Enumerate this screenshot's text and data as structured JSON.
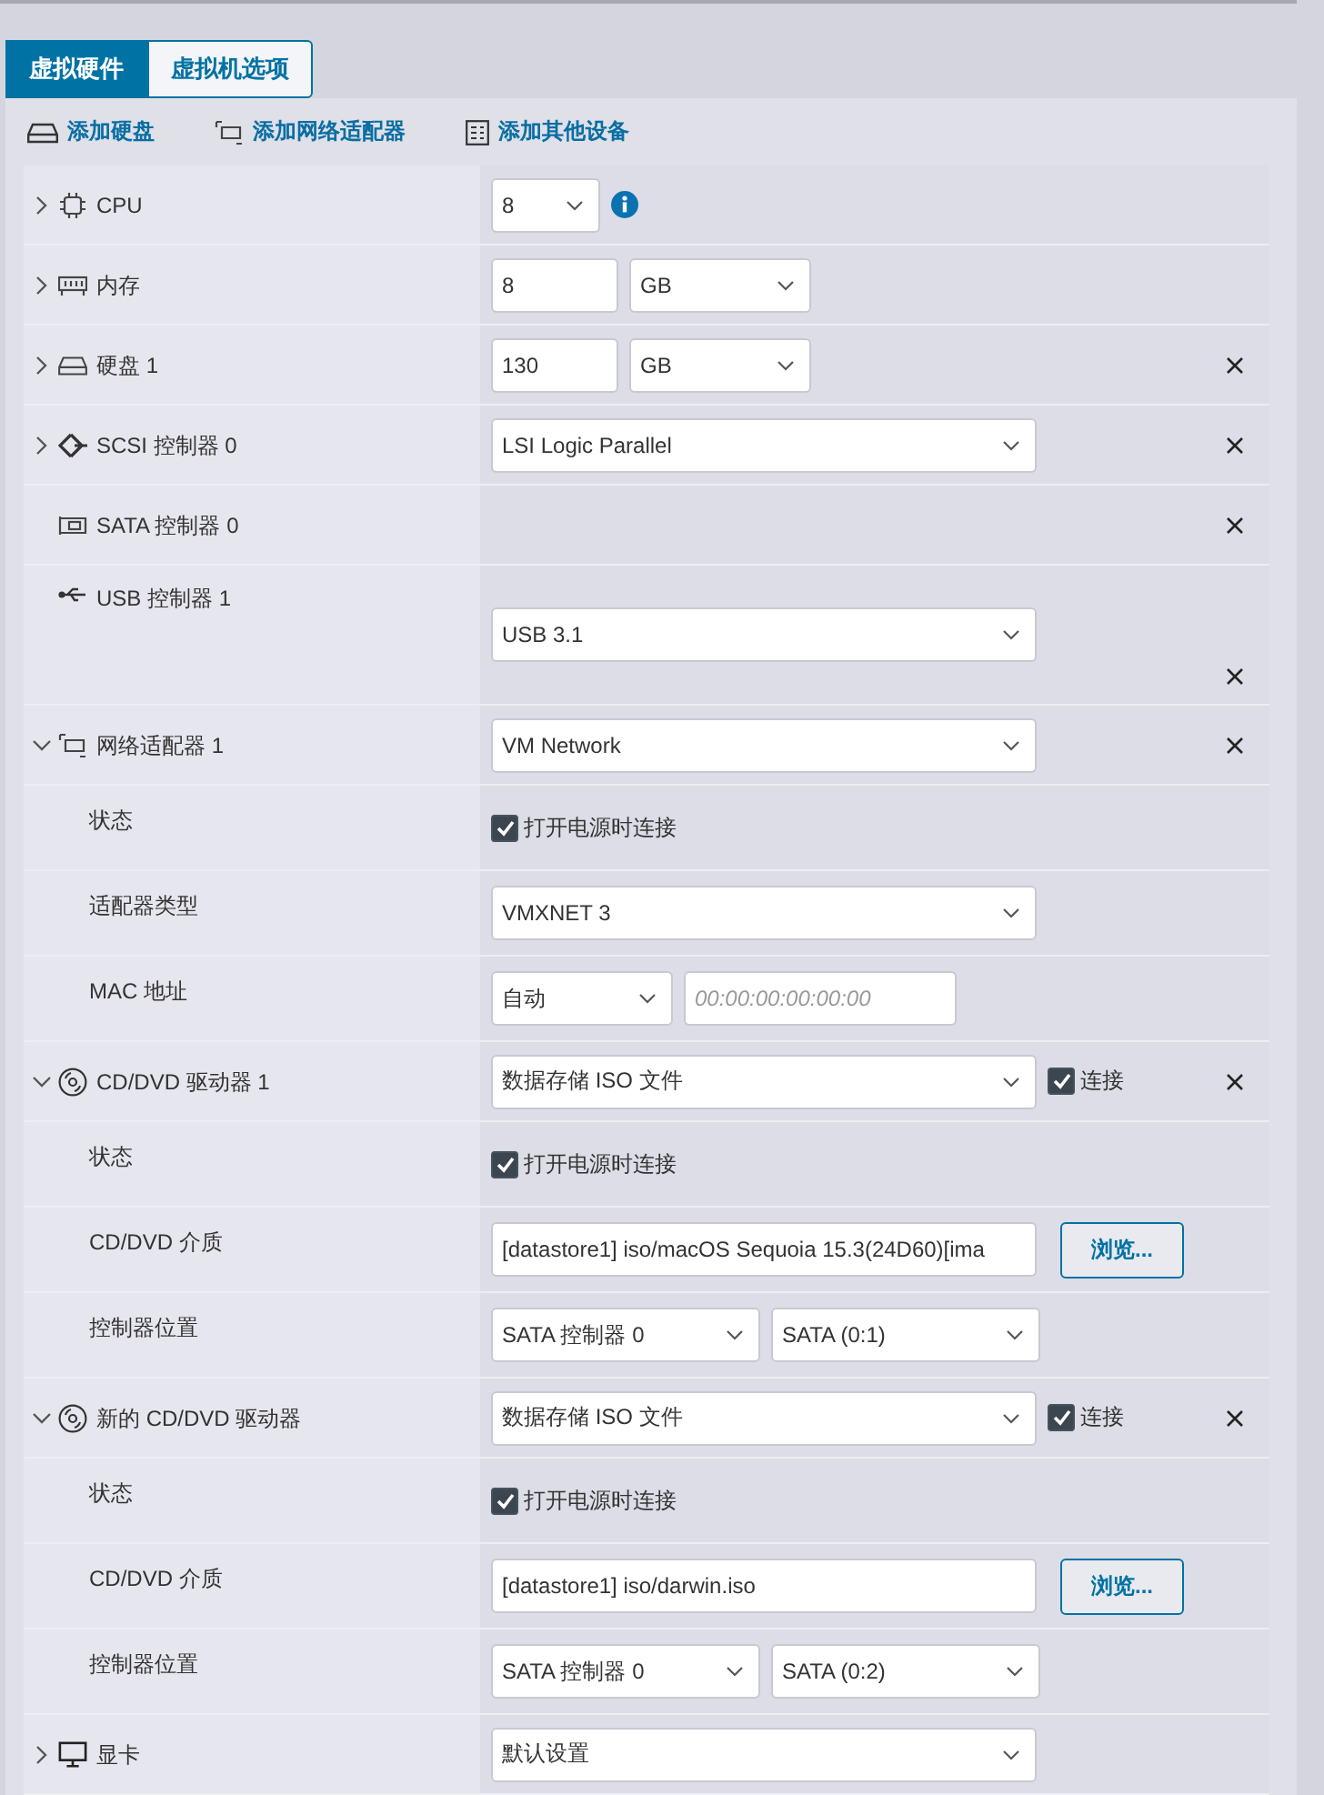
{
  "tabs": [
    {
      "label": "虚拟硬件",
      "selected": true
    },
    {
      "label": "虚拟机选项",
      "selected": false
    }
  ],
  "toolbar": [
    {
      "label": "添加硬盘"
    },
    {
      "label": "添加网络适配器"
    },
    {
      "label": "添加其他设备"
    }
  ],
  "rows": [
    {
      "kind": "cpu",
      "label": "CPU",
      "expanded": false,
      "removable": false,
      "controls": [
        {
          "kind": "picker",
          "value": "8"
        },
        {
          "kind": "info"
        }
      ]
    },
    {
      "kind": "memory",
      "label": "内存",
      "expanded": false,
      "removable": false,
      "controls": [
        {
          "kind": "number",
          "value": "8"
        },
        {
          "kind": "unit",
          "value": "GB"
        }
      ]
    },
    {
      "kind": "disk",
      "label": "硬盘 1",
      "expanded": false,
      "removable": true,
      "controls": [
        {
          "kind": "number",
          "value": "130"
        },
        {
          "kind": "unit",
          "value": "GB"
        }
      ]
    },
    {
      "kind": "scsi",
      "label": "SCSI 控制器 0",
      "expanded": false,
      "removable": true,
      "controls": [
        {
          "kind": "list",
          "value": "LSI Logic Parallel"
        }
      ]
    },
    {
      "kind": "sata",
      "label": "SATA 控制器 0",
      "removable": true,
      "controls": []
    },
    {
      "kind": "usb",
      "label": "USB 控制器 1",
      "removable": true,
      "controls": [
        {
          "kind": "list",
          "value": "USB 3.1"
        }
      ]
    },
    {
      "kind": "network",
      "label": "网络适配器 1",
      "expanded": true,
      "removable": true,
      "controls": [
        {
          "kind": "list",
          "value": "VM Network"
        }
      ],
      "children": [
        {
          "label": "状态",
          "controls": [
            {
              "kind": "checkbox",
              "label": "打开电源时连接",
              "checked": true
            }
          ]
        },
        {
          "label": "适配器类型",
          "controls": [
            {
              "kind": "list",
              "value": "VMXNET 3"
            }
          ]
        },
        {
          "label": "MAC 地址",
          "controls": [
            {
              "kind": "unit",
              "value": "自动"
            },
            {
              "kind": "address",
              "placeholder": "00:00:00:00:00:00"
            }
          ]
        }
      ]
    },
    {
      "kind": "cdrom",
      "label": "CD/DVD 驱动器 1",
      "expanded": true,
      "removable": true,
      "controls": [
        {
          "kind": "list",
          "value": "数据存储 ISO 文件"
        },
        {
          "kind": "checkbox",
          "label": "连接",
          "checked": true
        }
      ],
      "children": [
        {
          "label": "状态",
          "controls": [
            {
              "kind": "checkbox",
              "label": "打开电源时连接",
              "checked": true
            }
          ]
        },
        {
          "label": "CD/DVD 介质",
          "controls": [
            {
              "kind": "path",
              "value": "[datastore1] iso/macOS Sequoia 15.3(24D60)[ima"
            },
            {
              "kind": "button",
              "label": "浏览..."
            }
          ]
        },
        {
          "label": "控制器位置",
          "controls": [
            {
              "kind": "pair",
              "value": "SATA 控制器 0"
            },
            {
              "kind": "pair",
              "value": "SATA (0:1)"
            }
          ]
        }
      ]
    },
    {
      "kind": "cdrom",
      "label": "新的 CD/DVD 驱动器",
      "expanded": true,
      "removable": true,
      "controls": [
        {
          "kind": "list",
          "value": "数据存储 ISO 文件"
        },
        {
          "kind": "checkbox",
          "label": "连接",
          "checked": true
        }
      ],
      "children": [
        {
          "label": "状态",
          "controls": [
            {
              "kind": "checkbox",
              "label": "打开电源时连接",
              "checked": true
            }
          ]
        },
        {
          "label": "CD/DVD 介质",
          "controls": [
            {
              "kind": "path",
              "value": "[datastore1] iso/darwin.iso"
            },
            {
              "kind": "button",
              "label": "浏览..."
            }
          ]
        },
        {
          "label": "控制器位置",
          "controls": [
            {
              "kind": "pair",
              "value": "SATA 控制器 0"
            },
            {
              "kind": "pair",
              "value": "SATA (0:2)"
            }
          ]
        }
      ]
    },
    {
      "kind": "display",
      "label": "显卡",
      "expanded": false,
      "removable": false,
      "controls": [
        {
          "kind": "list",
          "value": "默认设置"
        }
      ]
    }
  ]
}
